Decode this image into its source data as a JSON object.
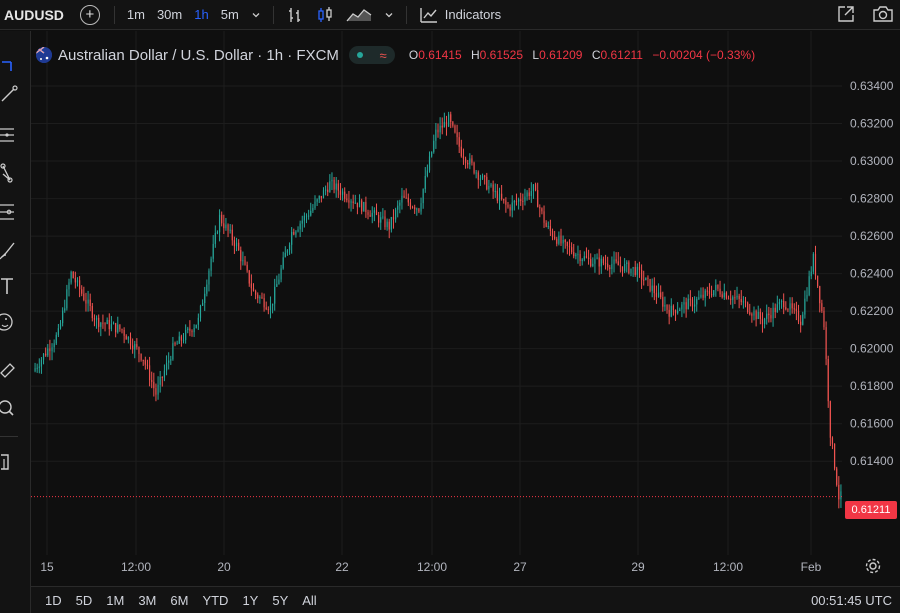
{
  "toolbar": {
    "symbol": "AUDUSD",
    "intervals": [
      "1m",
      "30m",
      "1h",
      "5m"
    ],
    "active_interval": "1h",
    "indicators_label": "Indicators"
  },
  "legend": {
    "title": "Australian Dollar / U.S. Dollar · 1h · FXCM",
    "o_label": "O",
    "o_value": "0.61415",
    "h_label": "H",
    "h_value": "0.61525",
    "l_label": "L",
    "l_value": "0.61209",
    "c_label": "C",
    "c_value": "0.61211",
    "change": "−0.00204 (−0.33%)"
  },
  "price_axis": {
    "labels": [
      "0.63400",
      "0.63200",
      "0.63000",
      "0.62800",
      "0.62600",
      "0.62400",
      "0.62200",
      "0.62000",
      "0.61800",
      "0.61600",
      "0.61400"
    ],
    "last_price": "0.61211"
  },
  "time_axis": {
    "labels": [
      "15",
      "12:00",
      "20",
      "22",
      "12:00",
      "27",
      "29",
      "12:00",
      "Feb"
    ]
  },
  "ranges": [
    "1D",
    "5D",
    "1M",
    "3M",
    "6M",
    "YTD",
    "1Y",
    "5Y",
    "All"
  ],
  "clock": "00:51:45 UTC",
  "colors": {
    "up": "#26a69a",
    "down": "#ef5350",
    "accent": "#2962ff",
    "last_price": "#f23645"
  },
  "chart_data": {
    "type": "candlestick",
    "ylim": [
      0.6114,
      0.6348
    ],
    "ticks_y": [
      0.634,
      0.632,
      0.63,
      0.628,
      0.626,
      0.624,
      0.622,
      0.62,
      0.618,
      0.616,
      0.614
    ],
    "anchors": [
      [
        0,
        0.6188
      ],
      [
        12,
        0.6208
      ],
      [
        18,
        0.624
      ],
      [
        30,
        0.6215
      ],
      [
        42,
        0.621
      ],
      [
        52,
        0.6195
      ],
      [
        58,
        0.6176
      ],
      [
        66,
        0.62
      ],
      [
        78,
        0.6215
      ],
      [
        88,
        0.627
      ],
      [
        96,
        0.6255
      ],
      [
        104,
        0.623
      ],
      [
        112,
        0.6222
      ],
      [
        122,
        0.6262
      ],
      [
        132,
        0.6275
      ],
      [
        140,
        0.6288
      ],
      [
        150,
        0.628
      ],
      [
        160,
        0.6272
      ],
      [
        168,
        0.6265
      ],
      [
        174,
        0.628
      ],
      [
        182,
        0.6275
      ],
      [
        190,
        0.6315
      ],
      [
        196,
        0.6322
      ],
      [
        202,
        0.6305
      ],
      [
        212,
        0.629
      ],
      [
        224,
        0.6275
      ],
      [
        236,
        0.6285
      ],
      [
        242,
        0.6265
      ],
      [
        250,
        0.6255
      ],
      [
        262,
        0.6247
      ],
      [
        274,
        0.6245
      ],
      [
        284,
        0.6242
      ],
      [
        292,
        0.6232
      ],
      [
        300,
        0.622
      ],
      [
        312,
        0.6225
      ],
      [
        322,
        0.6232
      ],
      [
        334,
        0.6225
      ],
      [
        344,
        0.6215
      ],
      [
        354,
        0.6225
      ],
      [
        362,
        0.6215
      ],
      [
        368,
        0.6248
      ],
      [
        373,
        0.6213
      ],
      [
        376,
        0.6155
      ],
      [
        380,
        0.6121
      ]
    ]
  }
}
